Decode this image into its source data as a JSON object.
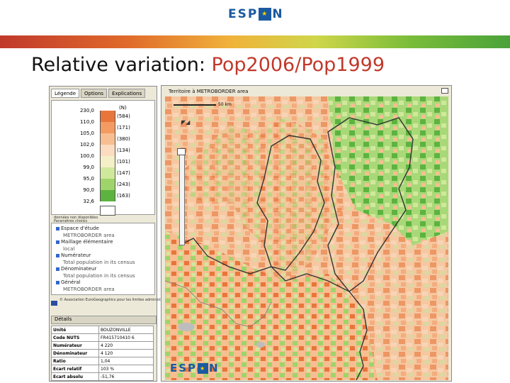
{
  "slide": {
    "logo_text_left": "ESP",
    "logo_text_right": "N",
    "title_prefix": "Relative variation: ",
    "title_highlight": "Pop2006/Pop1999",
    "colors": {
      "title_accent": "#c0392b",
      "logo_blue": "#1b5aa0"
    }
  },
  "panel": {
    "tabs": [
      "Légende",
      "Options",
      "Explications"
    ],
    "legend": {
      "unit": "(N)",
      "rows": [
        {
          "value": "230,0",
          "count": "(584)",
          "color": "#e8763a"
        },
        {
          "value": "110,0",
          "count": "(171)",
          "color": "#f39b63"
        },
        {
          "value": "105,0",
          "count": "(380)",
          "color": "#f7be91"
        },
        {
          "value": "102,0",
          "count": "(134)",
          "color": "#fbdcc0"
        },
        {
          "value": "100,0",
          "count": "(101)",
          "color": "#f3f0c8"
        },
        {
          "value": "99,0",
          "count": "(147)",
          "color": "#d0e89c"
        },
        {
          "value": "95,0",
          "count": "(243)",
          "color": "#9fd46a"
        },
        {
          "value": "90,0",
          "count": "(163)",
          "color": "#5db340"
        },
        {
          "value": "32,6",
          "count": "",
          "color": ""
        }
      ],
      "no_data_label": "données non disponibles"
    },
    "note": "Paramètres choisis",
    "tree": [
      {
        "label": "Espace d'étude",
        "sub": false
      },
      {
        "label": "METROBORDER area",
        "sub": true
      },
      {
        "label": "Maillage élémentaire",
        "sub": false
      },
      {
        "label": "local",
        "sub": true
      },
      {
        "label": "Numérateur",
        "sub": false
      },
      {
        "label": "Total population in its census",
        "sub": true
      },
      {
        "label": "Dénominateur",
        "sub": false
      },
      {
        "label": "Total population in its census",
        "sub": true
      },
      {
        "label": "Général",
        "sub": false
      },
      {
        "label": "METROBORDER area",
        "sub": true
      }
    ],
    "source": "© Association EuroGeographics pour les limites administratives",
    "details": {
      "header": "Détails",
      "rows": [
        {
          "k": "Unité",
          "v": "BOUZONVILLE"
        },
        {
          "k": "Code NUTS",
          "v": "FR415710410 6"
        },
        {
          "k": "Numérateur",
          "v": "4 220"
        },
        {
          "k": "Dénominateur",
          "v": "4 120"
        },
        {
          "k": "Ratio",
          "v": "1,04"
        },
        {
          "k": "Ecart relatif",
          "v": "103 %"
        },
        {
          "k": "Ecart absolu",
          "v": "-51,76"
        }
      ]
    }
  },
  "mapwin": {
    "title": "Territoire à METROBORDER area",
    "scale_label": "50 km"
  }
}
